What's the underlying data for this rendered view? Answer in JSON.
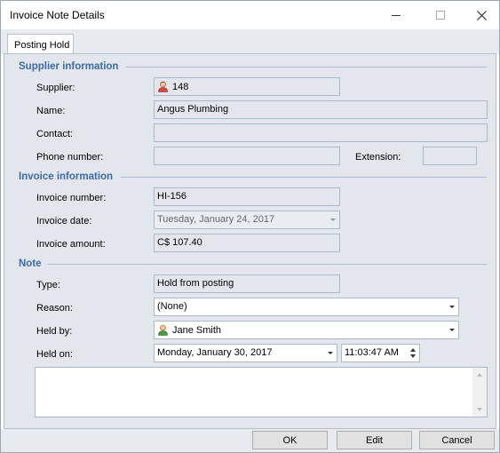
{
  "window": {
    "title": "Invoice Note Details"
  },
  "tabs": [
    {
      "label": "Posting Hold"
    }
  ],
  "supplier_section": {
    "title": "Supplier information",
    "supplier_label": "Supplier:",
    "supplier_value": "148",
    "name_label": "Name:",
    "name_value": "Angus Plumbing",
    "contact_label": "Contact:",
    "contact_value": "",
    "phone_label": "Phone number:",
    "phone_value": "",
    "extension_label": "Extension:",
    "extension_value": ""
  },
  "invoice_section": {
    "title": "Invoice information",
    "number_label": "Invoice number:",
    "number_value": "HI-156",
    "date_label": "Invoice date:",
    "date_value": "Tuesday, January 24, 2017",
    "amount_label": "Invoice amount:",
    "amount_value": "C$ 107.40"
  },
  "note_section": {
    "title": "Note",
    "type_label": "Type:",
    "type_value": "Hold from posting",
    "reason_label": "Reason:",
    "reason_value": "(None)",
    "heldby_label": "Held by:",
    "heldby_value": "Jane Smith",
    "heldon_label": "Held on:",
    "heldon_date": "Monday, January 30, 2017",
    "heldon_time": "11:03:47 AM",
    "memo_value": ""
  },
  "buttons": {
    "ok": "OK",
    "edit": "Edit",
    "cancel": "Cancel"
  },
  "icons": {
    "supplier": "supplier-person-icon",
    "user": "user-person-icon"
  },
  "colors": {
    "section_title": "#3c6aa8",
    "panel_bg": "#e3e7ed"
  }
}
